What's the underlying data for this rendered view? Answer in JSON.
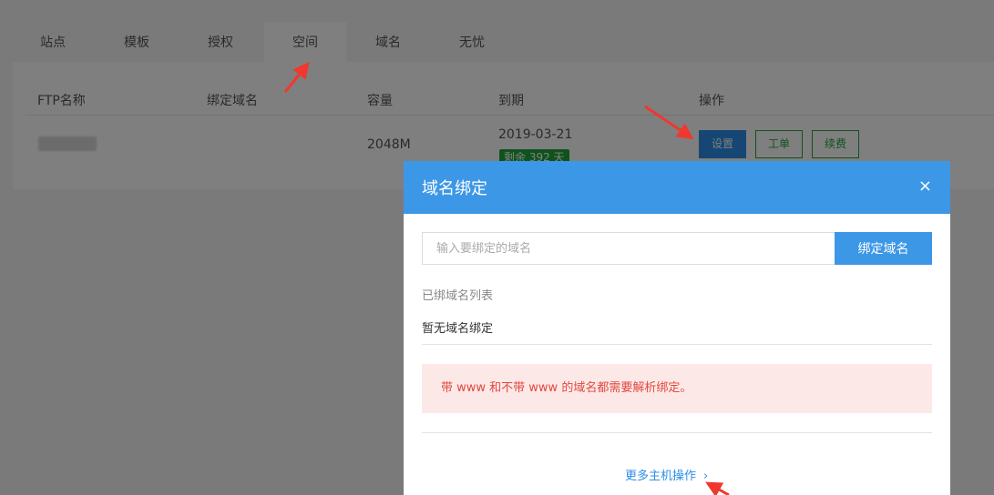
{
  "tabs": [
    {
      "label": "站点"
    },
    {
      "label": "模板"
    },
    {
      "label": "授权"
    },
    {
      "label": "空间",
      "active": true
    },
    {
      "label": "域名"
    },
    {
      "label": "无忧"
    }
  ],
  "table": {
    "headers": [
      "FTP名称",
      "绑定域名",
      "容量",
      "到期",
      "操作"
    ],
    "row": {
      "capacity": "2048M",
      "expire_date": "2019-03-21",
      "remaining": "剩余 392 天",
      "actions": [
        "设置",
        "工单",
        "续费"
      ]
    }
  },
  "dialog": {
    "title": "域名绑定",
    "close_symbol": "×",
    "input_placeholder": "输入要绑定的域名",
    "input_value": "",
    "bind_button": "绑定域名",
    "list_label": "已绑域名列表",
    "empty_text": "暂无域名绑定",
    "alert_text": "带 www 和不带 www 的域名都需要解析绑定。",
    "more_link": "更多主机操作",
    "more_icon": "chevron-right-icon"
  },
  "colors": {
    "primary": "#2c8ee8",
    "header_blue": "#3c97e6",
    "success_green": "#20a53a",
    "alert_red": "#e0483c",
    "alert_bg": "#fde8e8",
    "arrow_red": "#f0382e"
  }
}
